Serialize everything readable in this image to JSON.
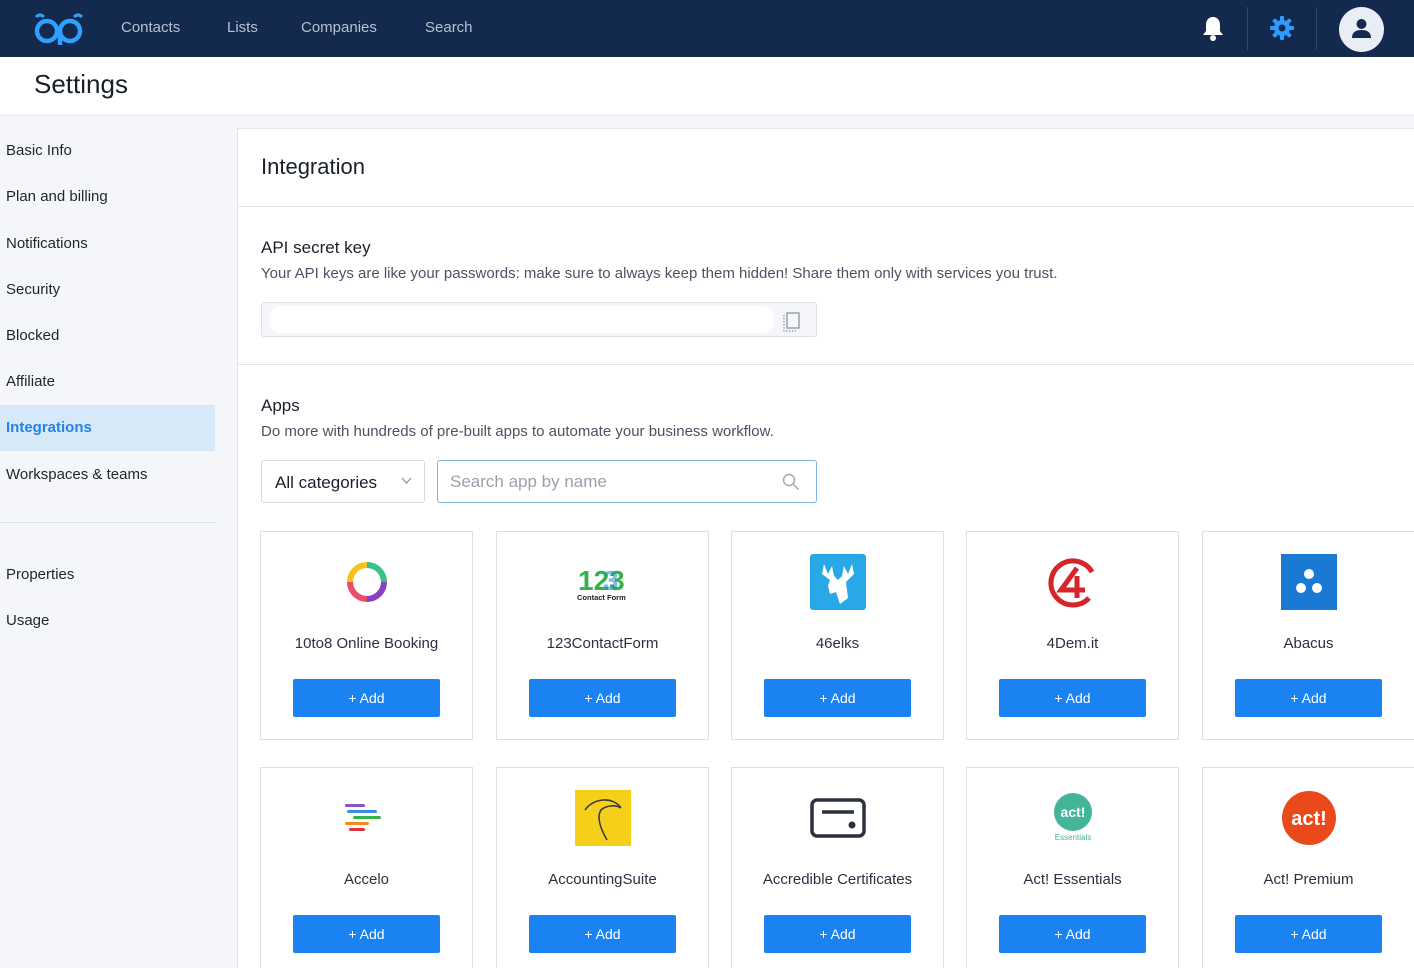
{
  "nav": {
    "links": [
      "Contacts",
      "Lists",
      "Companies",
      "Search"
    ]
  },
  "page": {
    "title": "Settings"
  },
  "sidebar": {
    "items": [
      {
        "label": "Basic Info",
        "active": false
      },
      {
        "label": "Plan and billing",
        "active": false
      },
      {
        "label": "Notifications",
        "active": false
      },
      {
        "label": "Security",
        "active": false
      },
      {
        "label": "Blocked",
        "active": false
      },
      {
        "label": "Affiliate",
        "active": false
      },
      {
        "label": "Integrations",
        "active": true
      },
      {
        "label": "Workspaces & teams",
        "active": false
      }
    ],
    "secondary_items": [
      "Properties",
      "Usage"
    ]
  },
  "integration": {
    "title": "Integration",
    "api": {
      "title": "API secret key",
      "description": "Your API keys are like your passwords: make sure to always keep them hidden! Share them only with services you trust.",
      "value": ""
    },
    "apps": {
      "title": "Apps",
      "description": "Do more with hundreds of pre-built apps to automate your business workflow.",
      "category_selected": "All categories",
      "search_placeholder": "Search app by name",
      "add_label": "+ Add",
      "cards": [
        {
          "name": "10to8 Online Booking",
          "icon": "ring-logo-icon"
        },
        {
          "name": "123ContactForm",
          "icon": "contactform-logo-icon",
          "logo_text": "123",
          "logo_subtext": "Contact Form"
        },
        {
          "name": "46elks",
          "icon": "elk-logo-icon"
        },
        {
          "name": "4Dem.it",
          "icon": "4dem-logo-icon"
        },
        {
          "name": "Abacus",
          "icon": "abacus-logo-icon"
        },
        {
          "name": "Accelo",
          "icon": "accelo-logo-icon"
        },
        {
          "name": "AccountingSuite",
          "icon": "accountingsuite-logo-icon"
        },
        {
          "name": "Accredible Certificates",
          "icon": "certificate-logo-icon"
        },
        {
          "name": "Act! Essentials",
          "icon": "act-essentials-logo-icon",
          "logo_text": "act!",
          "logo_subtext": "Essentials"
        },
        {
          "name": "Act! Premium",
          "icon": "act-premium-logo-icon",
          "logo_text": "act!"
        }
      ]
    }
  },
  "colors": {
    "topbar": "#132a4e",
    "accent": "#1a82f1",
    "active_bg": "#d7e8f9"
  }
}
